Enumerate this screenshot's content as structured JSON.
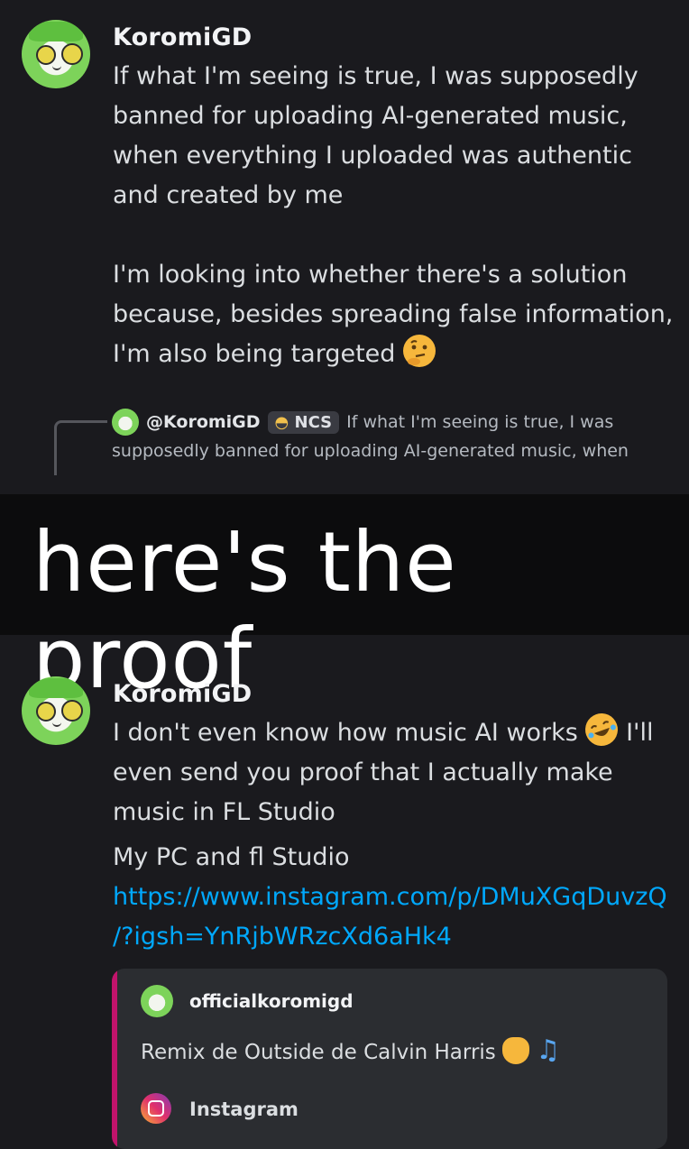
{
  "message1": {
    "username": "KoromiGD",
    "lines": [
      "If what I'm seeing is true, I was supposedly",
      "banned for uploading AI-generated music,",
      "when everything I uploaded was authentic",
      "and created by me"
    ],
    "lines2": [
      "I'm looking into whether there's a solution",
      "because, besides spreading false information,",
      "I'm also being targeted"
    ]
  },
  "reply": {
    "mention": "@KoromiGD",
    "tag": "NCS",
    "text1": "If what I'm seeing is true, I was",
    "text2": "supposedly banned for uploading AI-generated music, when"
  },
  "caption": "here's the proof",
  "message2": {
    "username": "KoromiGD",
    "line1": "I don't even know how music AI works",
    "line1_tail": "I'll",
    "line2": "even send you proof that I actually make",
    "line3": "music in FL Studio",
    "line4": "My PC and fl Studio",
    "link1": "https://www.instagram.com/p/DMuXGqDuvzQ",
    "link2": "/?igsh=YnRjbWRzcXd6aHk4"
  },
  "embed": {
    "author": "officialkoromigd",
    "description": "Remix de Outside de Calvin Harris",
    "provider": "Instagram",
    "accent_color": "#c1136b"
  },
  "colors": {
    "background": "#1a1a1e",
    "link": "#00a8fc"
  }
}
